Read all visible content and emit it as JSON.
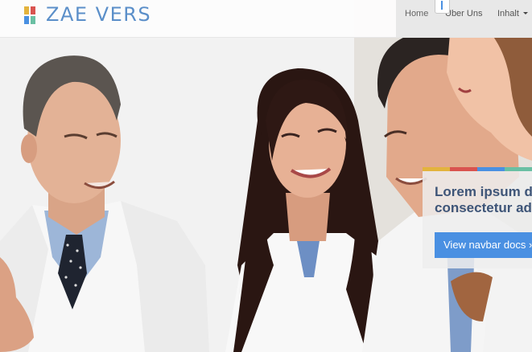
{
  "navbar": {
    "brand": "ZAE VERS",
    "logo_colors": [
      "#e3b33d",
      "#d9534f",
      "#4a90e2",
      "#6abfa3"
    ],
    "links": [
      {
        "label": "Home",
        "active": true
      },
      {
        "label": "Über Uns",
        "active": false
      },
      {
        "label": "Inhalt",
        "active": false,
        "dropdown": true
      }
    ]
  },
  "hero": {
    "image": "medical-team-photo",
    "caption": {
      "heading": "Lorem ipsum d\nconsectetur ad",
      "button_label": "View navbar docs »",
      "stripe_colors": [
        "#e3b33d",
        "#d9534f",
        "#4a90e2",
        "#6abfa3"
      ]
    }
  },
  "colors": {
    "brand_blue": "#5b8fc9",
    "button_blue": "#4a90e2",
    "heading_navy": "#3e5578"
  }
}
